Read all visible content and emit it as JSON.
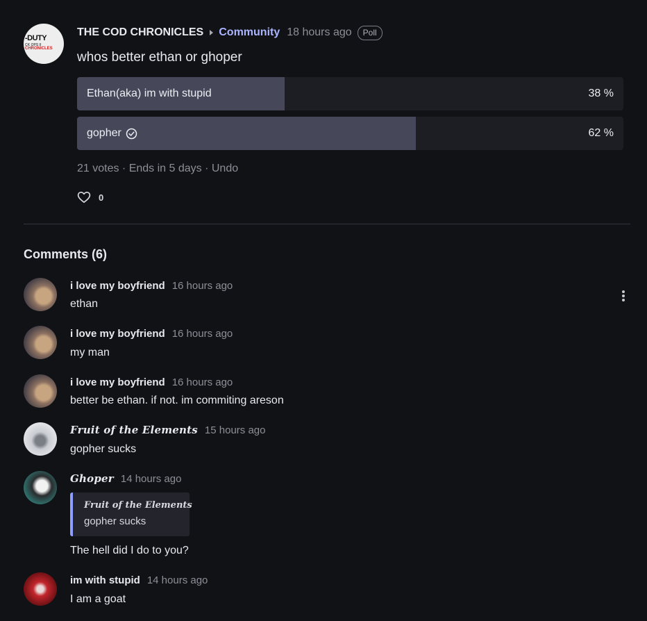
{
  "post": {
    "community": "THE COD CHRONICLES",
    "category": "Community",
    "time": "18 hours ago",
    "badge": "Poll",
    "title": "whos better ethan or ghoper",
    "avatar_text": {
      "line1": "-DUTY",
      "line2": "CK OPS II",
      "line3": "CHRONICLES"
    }
  },
  "poll": {
    "options": [
      {
        "label": "Ethan(aka) im with stupid",
        "percent_text": "38 %",
        "percent": 38,
        "selected": false
      },
      {
        "label": "gopher",
        "percent_text": "62 %",
        "percent": 62,
        "selected": true
      }
    ],
    "votes_text": "21 votes",
    "ends_text": "Ends in 5 days",
    "undo_label": "Undo",
    "separator": " · "
  },
  "likes": {
    "count": "0"
  },
  "comments_heading": "Comments (6)",
  "comments": [
    {
      "author": "i love my boyfriend",
      "time": "16 hours ago",
      "text": "ethan"
    },
    {
      "author": "i love my boyfriend",
      "time": "16 hours ago",
      "text": "my man"
    },
    {
      "author": "i love my boyfriend",
      "time": "16 hours ago",
      "text": "better be ethan. if not. im commiting areson"
    },
    {
      "author": "Fruit of the Elements",
      "time": "15 hours ago",
      "text": "gopher sucks"
    },
    {
      "author": "Ghoper",
      "time": "14 hours ago",
      "text": "The hell did I do to you?",
      "quote": {
        "author": "Fruit of the Elements",
        "text": "gopher sucks"
      }
    },
    {
      "author": "im with stupid",
      "time": "14 hours ago",
      "text": "I am a goat"
    }
  ],
  "colors": {
    "background": "#111216",
    "accent": "#aab4ff",
    "quote_border": "#8f9dff",
    "poll_fill": "#46485a",
    "poll_track": "#1d1e24"
  },
  "icons": {
    "breadcrumb": "caret-right-icon",
    "selected_option": "check-circle-icon",
    "like": "heart-icon",
    "menu": "more-vertical-icon"
  }
}
